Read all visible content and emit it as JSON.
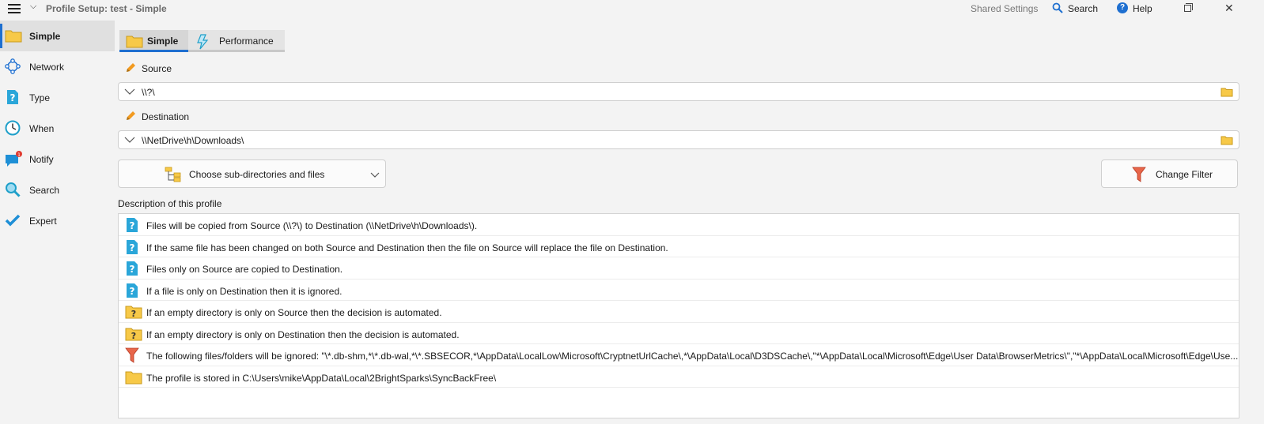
{
  "titlebar": {
    "title": "Profile Setup: test - Simple",
    "shared_settings": "Shared Settings",
    "search": "Search",
    "help": "Help",
    "help_icon": "?",
    "close": "✕"
  },
  "sidebar": {
    "items": [
      {
        "label": "Simple",
        "icon": "folder-icon"
      },
      {
        "label": "Network",
        "icon": "network-icon"
      },
      {
        "label": "Type",
        "icon": "question-doc-icon"
      },
      {
        "label": "When",
        "icon": "clock-icon"
      },
      {
        "label": "Notify",
        "icon": "notify-icon",
        "badge": "1"
      },
      {
        "label": "Search",
        "icon": "magnifier-icon"
      },
      {
        "label": "Expert",
        "icon": "check-icon"
      }
    ]
  },
  "tabs": [
    {
      "label": "Simple",
      "icon": "folder-icon"
    },
    {
      "label": "Performance",
      "icon": "lightning-icon"
    }
  ],
  "source": {
    "label": "Source",
    "value": "\\\\?\\"
  },
  "destination": {
    "label": "Destination",
    "value": "\\\\NetDrive\\h\\Downloads\\"
  },
  "buttons": {
    "subdirs": "Choose sub-directories and files",
    "filter": "Change Filter"
  },
  "description": {
    "title": "Description of this profile",
    "rows": [
      {
        "icon": "question-doc-icon",
        "text": "Files will be copied from Source (\\\\?\\) to Destination (\\\\NetDrive\\h\\Downloads\\)."
      },
      {
        "icon": "question-doc-icon",
        "text": "If the same file has been changed on both Source and Destination then the file on Source will replace the file on Destination."
      },
      {
        "icon": "question-doc-icon",
        "text": "Files only on Source are copied to Destination."
      },
      {
        "icon": "question-doc-icon",
        "text": "If a file is only on Destination then it is ignored."
      },
      {
        "icon": "question-folder-icon",
        "text": "If an empty directory is only on Source then the decision is automated."
      },
      {
        "icon": "question-folder-icon",
        "text": "If an empty directory is only on Destination then the decision is automated."
      },
      {
        "icon": "filter-icon",
        "text": "The following files/folders will be ignored: \"\\*.db-shm,*\\*.db-wal,*\\*.SBSECOR,*\\AppData\\LocalLow\\Microsoft\\CryptnetUrlCache\\,*\\AppData\\Local\\D3DSCache\\,\"*\\AppData\\Local\\Microsoft\\Edge\\User Data\\BrowserMetrics\\\",\"*\\AppData\\Local\\Microsoft\\Edge\\Use..."
      },
      {
        "icon": "folder-icon",
        "text": "The profile is stored in C:\\Users\\mike\\AppData\\Local\\2BrightSparks\\SyncBackFree\\"
      }
    ]
  },
  "colors": {
    "accent": "#1e6fd0",
    "folder": "#f7c948",
    "question": "#2aa6d9",
    "filter": "#e0533a"
  }
}
